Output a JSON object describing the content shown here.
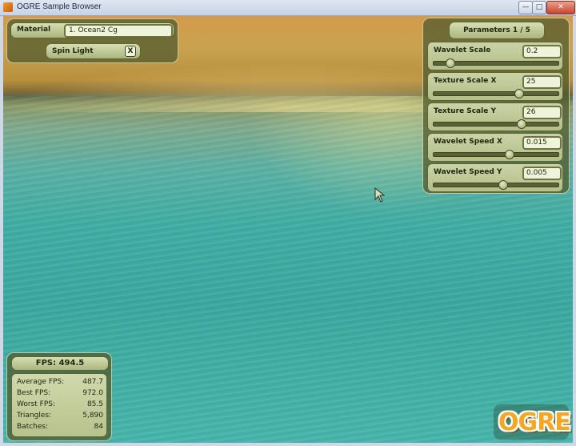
{
  "window": {
    "title": "OGRE Sample Browser",
    "controls": {
      "minimize": "—",
      "maximize": "□",
      "close": "✕"
    }
  },
  "material_panel": {
    "material_label": "Material",
    "material_value": "1. Ocean2 Cg",
    "spin_light_label": "Spin Light",
    "spin_light_check": "X"
  },
  "params_panel": {
    "header": "Parameters 1 / 5",
    "sliders": [
      {
        "label": "Wavelet Scale",
        "value": "0.2",
        "position": 0.13
      },
      {
        "label": "Texture Scale X",
        "value": "25",
        "position": 0.68
      },
      {
        "label": "Texture Scale Y",
        "value": "26",
        "position": 0.7
      },
      {
        "label": "Wavelet Speed X",
        "value": "0.015",
        "position": 0.6
      },
      {
        "label": "Wavelet Speed Y",
        "value": "0.005",
        "position": 0.55
      }
    ]
  },
  "stats_panel": {
    "fps": "FPS: 494.5",
    "rows": [
      {
        "label": "Average FPS:",
        "value": "487.7"
      },
      {
        "label": "Best FPS:",
        "value": "972.0"
      },
      {
        "label": "Worst FPS:",
        "value": "85.5"
      },
      {
        "label": "Triangles:",
        "value": "5,890"
      },
      {
        "label": "Batches:",
        "value": "84"
      }
    ]
  },
  "logo": {
    "text": "OGRE"
  },
  "colors": {
    "panel": "#4e582c",
    "widget": "#c9d3a6",
    "ocean": "#3fada4",
    "sky": "#d49a4b"
  }
}
